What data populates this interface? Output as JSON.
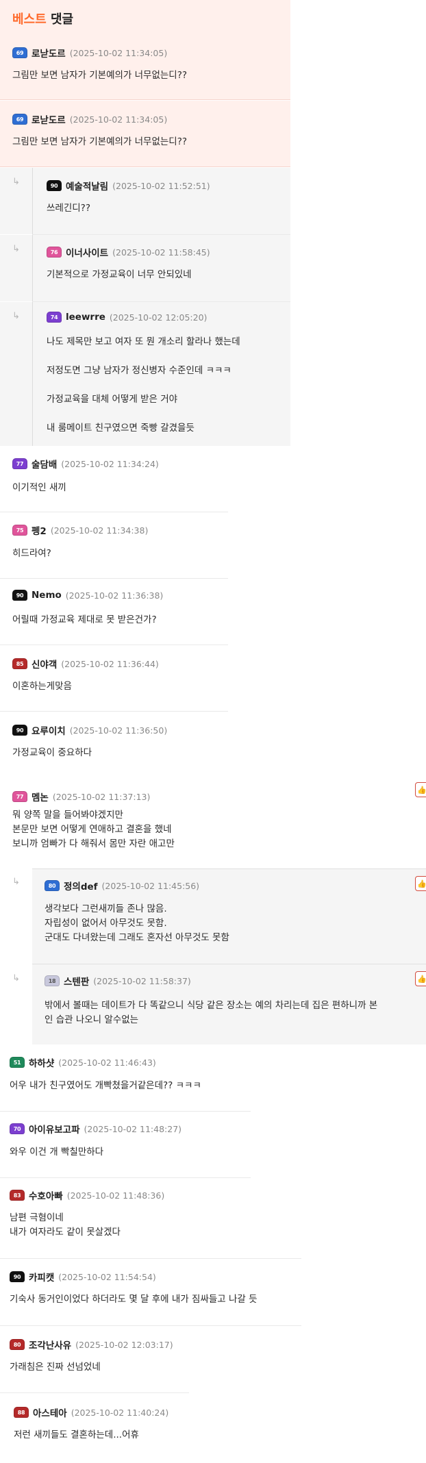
{
  "best_header": {
    "part1": "베스트",
    "part2": "댓글"
  },
  "best_comments": [
    {
      "level": "69",
      "color": "#2f6ed3",
      "nick": "로낟도르",
      "time": "(2025-10-02 11:34:05)",
      "text": "그림만 보면 남자가 기본예의가 너무없는디??"
    },
    {
      "level": "69",
      "color": "#2f6ed3",
      "nick": "로낟도르",
      "time": "(2025-10-02 11:34:05)",
      "text": "그림만 보면 남자가 기본예의가 너무없는디??"
    }
  ],
  "best_replies": [
    {
      "level": "90",
      "color": "#111111",
      "nick": "예술적날림",
      "time": "(2025-10-02 11:52:51)",
      "lines": [
        "쓰레긴디??"
      ]
    },
    {
      "level": "76",
      "color": "#e0559b",
      "nick": "이너사이트",
      "time": "(2025-10-02 11:58:45)",
      "lines": [
        "기본적으로 가정교육이 너무 안되있네"
      ]
    },
    {
      "level": "74",
      "color": "#7c3fd0",
      "nick": "leewrre",
      "time": "(2025-10-02 12:05:20)",
      "lines": [
        "나도 제목만 보고 여자 또 뭔 개소리 할라나 했는데",
        "저정도면 그냥 남자가 정신병자 수준인데 ㅋㅋㅋ",
        "가정교육을 대체 어떻게 받은 거야",
        "내 룸메이트 친구였으면 죽빵 갈겼을듯"
      ]
    }
  ],
  "comments": [
    {
      "level": "77",
      "color": "#7c3fd0",
      "nick": "술담배",
      "time": "(2025-10-02 11:34:24)",
      "text": "이기적인 새끼"
    },
    {
      "level": "75",
      "color": "#e0559b",
      "nick": "펭2",
      "time": "(2025-10-02 11:34:38)",
      "text": "히드라여?"
    },
    {
      "level": "90",
      "color": "#111111",
      "nick": "Nemo",
      "time": "(2025-10-02 11:36:38)",
      "text": "어릴때 가정교육 제대로 못 받은건가?"
    },
    {
      "level": "85",
      "color": "#b52a2a",
      "nick": "신야객",
      "time": "(2025-10-02 11:36:44)",
      "text": "이혼하는게맞음"
    },
    {
      "level": "90",
      "color": "#111111",
      "nick": "요루이치",
      "time": "(2025-10-02 11:36:50)",
      "text": "가정교육이 중요하다"
    },
    {
      "level": "77",
      "color": "#e0559b",
      "nick": "멤논",
      "time": "(2025-10-02 11:37:13)",
      "text": "뭐 양쪽 말을 들어봐야겠지만\n본문만 보면 어떻게 연애하고 결혼을 했네\n보니까 엄빠가 다 해줘서 몸만 자란 애고만"
    }
  ],
  "memnon_replies": [
    {
      "level": "80",
      "color": "#2f6ed3",
      "nick": "정의def",
      "time": "(2025-10-02 11:45:56)",
      "text": "생각보다 그런새끼들 존나 많음.\n자립성이 없어서 아무것도 못함.\n군대도 다녀왔는데 그래도 혼자선 아무것도 못함"
    },
    {
      "level": "18",
      "color": "#c8c8dc",
      "nick": "스텐판",
      "time": "(2025-10-02 11:58:37)",
      "text": "밖에서 볼때는 데이트가 다 똑같으니 식당 같은 장소는 예의 차리는데 집은 편하니까 본\n인 습관 나오니 알수없는"
    }
  ],
  "comments2": [
    {
      "level": "51",
      "color": "#1f8a5b",
      "nick": "하하샷",
      "time": "(2025-10-02 11:46:43)",
      "text": "어우 내가 친구였어도 개빡쳤을거같은데?? ㅋㅋㅋ"
    },
    {
      "level": "70",
      "color": "#7c3fd0",
      "nick": "아이유보고파",
      "time": "(2025-10-02 11:48:27)",
      "text": "와우 이건 개 빡칠만하다"
    },
    {
      "level": "83",
      "color": "#b52a2a",
      "nick": "수호아빠",
      "time": "(2025-10-02 11:48:36)",
      "text": "남편 극혐이네\n내가 여자라도 같이 못살겠다"
    },
    {
      "level": "90",
      "color": "#111111",
      "nick": "카피캣",
      "time": "(2025-10-02 11:54:54)",
      "text": "기숙사 동거인이었다 하더라도 몇 달 후에 내가 짐싸들고 나갈 듯"
    },
    {
      "level": "80",
      "color": "#b52a2a",
      "nick": "조각난사유",
      "time": "(2025-10-02 12:03:17)",
      "text": "가래침은 진짜 선넘었네"
    },
    {
      "level": "88",
      "color": "#b52a2a",
      "nick": "아스테아",
      "time": "(2025-10-02 11:40:24)",
      "text": "저런 새끼들도 결혼하는데...어휴"
    }
  ],
  "icons": {
    "reply_arrow": "↳",
    "thumb": "👍"
  }
}
